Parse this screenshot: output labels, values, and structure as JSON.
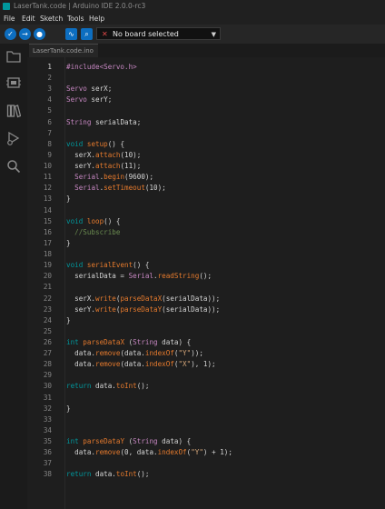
{
  "window": {
    "title": "LaserTank.code | Arduino IDE 2.0.0-rc3"
  },
  "menu": [
    "File",
    "Edit",
    "Sketch",
    "Tools",
    "Help"
  ],
  "toolbar": {
    "board_label": "No board selected",
    "buttons": [
      "verify-icon",
      "upload-icon",
      "debugger-icon",
      "serial-plotter-icon",
      "serial-monitor-icon"
    ]
  },
  "sidebar": {
    "icons": [
      "sketchbook-icon",
      "boards-manager-icon",
      "library-manager-icon",
      "debug-icon",
      "search-icon"
    ]
  },
  "tabs": [
    "LaserTank.code.ino"
  ],
  "editor": {
    "active_line": 1,
    "lines": [
      "#include<Servo.h>",
      "",
      "Servo serX;",
      "Servo serY;",
      "",
      "String serialData;",
      "",
      "void setup() {",
      "  serX.attach(10);",
      "  serY.attach(11);",
      "  Serial.begin(9600);",
      "  Serial.setTimeout(10);",
      "}",
      "",
      "void loop() {",
      "  //Subscribe",
      "}",
      "",
      "void serialEvent() {",
      "  serialData = Serial.readString();",
      "",
      "  serX.write(parseDataX(serialData));",
      "  serY.write(parseDataY(serialData));",
      "}",
      "",
      "int parseDataX (String data) {",
      "  data.remove(data.indexOf(\"Y\"));",
      "  data.remove(data.indexOf(\"X\"), 1);",
      "",
      "return data.toInt();",
      "",
      "}",
      "",
      "",
      "int parseDataY (String data) {",
      "  data.remove(0, data.indexOf(\"Y\") + 1);",
      "",
      "return data.toInt();"
    ]
  },
  "colors": {
    "keyword": "#00979c",
    "function": "#e57a2d",
    "class": "#c586c0",
    "string": "#d6a77a",
    "comment": "#6a8a4f",
    "accent": "#0d6ec0"
  }
}
